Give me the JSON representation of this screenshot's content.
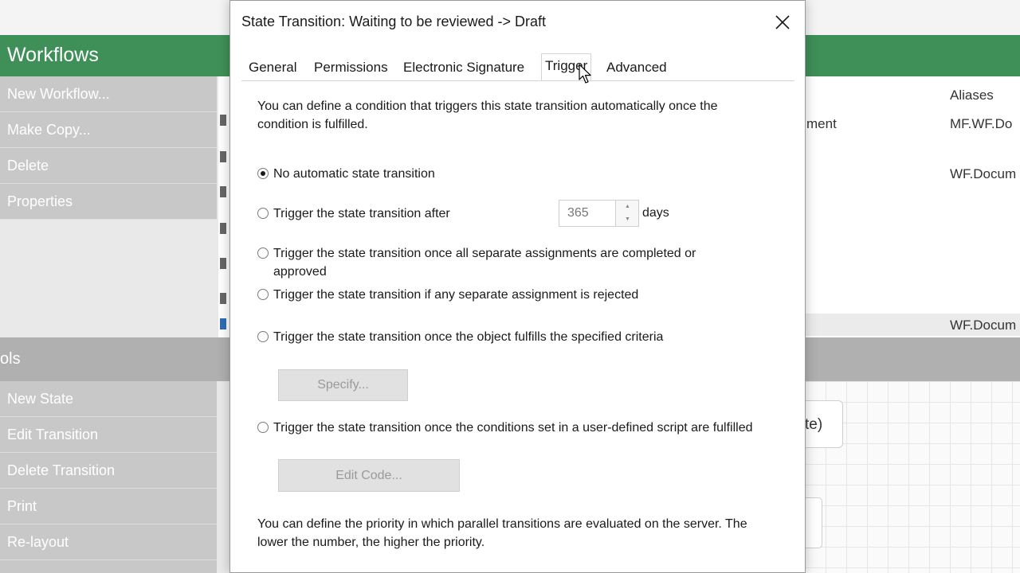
{
  "app": {
    "title": "Workflows",
    "commands": [
      {
        "label": "New Workflow..."
      },
      {
        "label": "Make Copy..."
      },
      {
        "label": "Delete"
      },
      {
        "label": "Properties"
      }
    ],
    "tools_label": "ols",
    "tools": [
      {
        "label": "New State"
      },
      {
        "label": "Edit Transition"
      },
      {
        "label": "Delete Transition"
      },
      {
        "label": "Print"
      },
      {
        "label": "Re-layout"
      }
    ],
    "list": {
      "aliases_header": "Aliases",
      "row1_name_fragment": "ment",
      "row1_alias": "MF.WF.Do",
      "row2_alias": "WF.Docum",
      "row3_alias": "WF.Docum"
    },
    "diagram_node_fragment": "te)"
  },
  "dialog": {
    "title": "State Transition: Waiting to be reviewed -> Draft",
    "tabs": [
      {
        "label": "General"
      },
      {
        "label": "Permissions"
      },
      {
        "label": "Electronic Signature"
      },
      {
        "label": "Trigger"
      },
      {
        "label": "Advanced"
      }
    ],
    "active_tab": "Trigger",
    "intro": "You can define a condition that triggers this state transition automatically once the condition is fulfilled.",
    "options": [
      {
        "label": "No automatic state transition",
        "checked": true
      },
      {
        "label": "Trigger the state transition after",
        "checked": false
      },
      {
        "label": "Trigger the state transition once all separate assignments are completed or approved",
        "checked": false
      },
      {
        "label": "Trigger the state transition if any separate assignment is rejected",
        "checked": false
      },
      {
        "label": "Trigger the state transition once the object fulfills the specified criteria",
        "checked": false
      },
      {
        "label": "Trigger the state transition once the conditions set in a user-defined script are fulfilled",
        "checked": false
      }
    ],
    "days_value": "365",
    "days_unit": "days",
    "specify_button": "Specify...",
    "edit_code_button": "Edit Code...",
    "priority_text": "You can define the priority in which parallel transitions are evaluated on the server. The lower the number, the higher the priority."
  }
}
